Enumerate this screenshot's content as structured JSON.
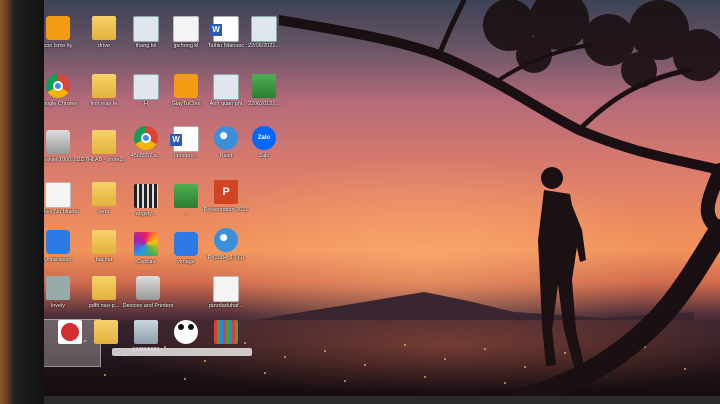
{
  "desktop": {
    "icons": [
      {
        "label": "con lsmo lty",
        "kind": "orange"
      },
      {
        "label": "drive",
        "kind": "folder"
      },
      {
        "label": "thang lol",
        "kind": "folder"
      },
      {
        "label": "jpchong kl",
        "kind": "doc"
      },
      {
        "label": "Taihiu Ntanuoc",
        "kind": "word"
      },
      {
        "label": "22/06/2021...",
        "kind": "shot"
      },
      {
        "label": "Google Chrome",
        "kind": "chrome"
      },
      {
        "label": "linh may le",
        "kind": "folder"
      },
      {
        "label": "H",
        "kind": "shot"
      },
      {
        "label": "GiayTuChoi",
        "kind": "orange"
      },
      {
        "label": "Anh quan pht",
        "kind": "shot"
      },
      {
        "label": "220620121...",
        "kind": "green"
      },
      {
        "label": "HP Deskjet 1000 J11...",
        "kind": "printer"
      },
      {
        "label": "DTHLAB - prote2...",
        "kind": "folder"
      },
      {
        "label": "4565557 a...",
        "kind": "chrome"
      },
      {
        "label": "tinhdem...",
        "kind": "word"
      },
      {
        "label": "Paint",
        "kind": "paint"
      },
      {
        "label": "Zalo",
        "kind": "zalo"
      },
      {
        "label": "unikey Nu bluebe",
        "kind": "doc"
      },
      {
        "label": "peru",
        "kind": "folder"
      },
      {
        "label": "abgsty...",
        "kind": "film"
      },
      {
        "label": "...",
        "kind": "green"
      },
      {
        "label": "Presentation 2021",
        "kind": "ppt"
      },
      {
        "label": "Ultraviewer",
        "kind": "blue"
      },
      {
        "label": "bachat",
        "kind": "folder"
      },
      {
        "label": "Captura",
        "kind": "multi"
      },
      {
        "label": "vlmage",
        "kind": "blue"
      },
      {
        "label": "PY2084_13 (1)",
        "kind": "paint"
      },
      {
        "label": "lovely",
        "kind": "gray"
      },
      {
        "label": "pdfit nao-p...",
        "kind": "folder"
      },
      {
        "label": "Devices and Printers",
        "kind": "printer"
      },
      {
        "label": "pizzdaduhaf...",
        "kind": "doc"
      },
      {
        "label": "",
        "kind": "red"
      },
      {
        "label": "",
        "kind": "folder"
      },
      {
        "label": "17/03/2021",
        "kind": "recycle"
      },
      {
        "label": "",
        "kind": "panda"
      },
      {
        "label": "",
        "kind": "bars"
      }
    ]
  }
}
